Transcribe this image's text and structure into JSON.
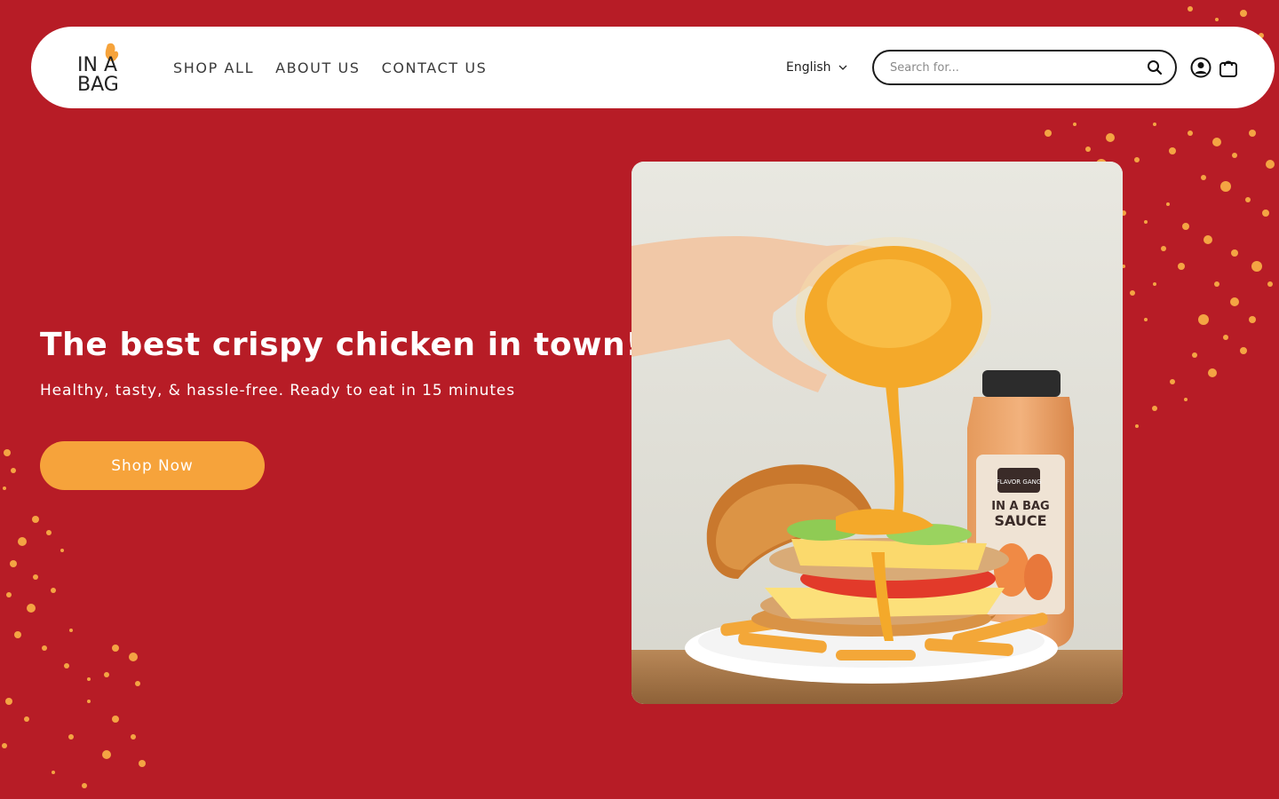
{
  "brand": {
    "logo_line1": "IN A",
    "logo_line2": "BAG"
  },
  "nav": {
    "items": [
      {
        "label": "SHOP ALL"
      },
      {
        "label": "ABOUT US"
      },
      {
        "label": "CONTACT US"
      }
    ]
  },
  "language": {
    "selected": "English"
  },
  "search": {
    "placeholder": "Search for..."
  },
  "hero": {
    "title": "The best crispy chicken in town!",
    "subtitle": "Healthy, tasty, & hassle-free. Ready to eat in 15 minutes",
    "cta_label": "Shop Now",
    "bottle_label_top": "FLAVOR GANG",
    "bottle_label_line1": "IN A BAG",
    "bottle_label_line2": "SAUCE"
  },
  "colors": {
    "background": "#b71c26",
    "header_bg": "#ffffff",
    "accent": "#f6a33b",
    "text_on_red": "#ffffff"
  },
  "icons": {
    "search": "search-icon",
    "account": "account-icon",
    "cart": "cart-icon",
    "language_chevron": "chevron-down-icon"
  }
}
